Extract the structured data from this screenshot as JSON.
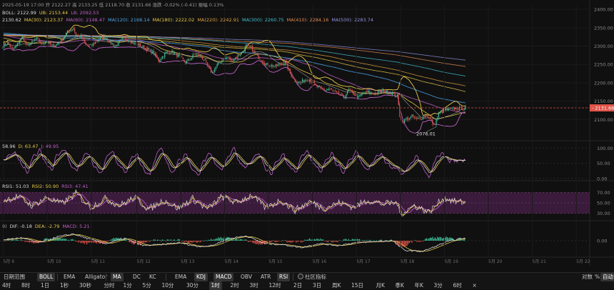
{
  "header": {
    "line1": "2025-05-19 17:00  开 2122.27  高 2133.25  低 2118.70  收 2131.66  涨跌 -0.02% (-0.41)  振幅 0.13%",
    "line2": [
      {
        "text": "BOLL: 2122.99",
        "color": "#d8d8d8"
      },
      {
        "text": "UB: 2153.44",
        "color": "#e6c84a"
      },
      {
        "text": "LB: 2092.53",
        "color": "#c060c8"
      }
    ],
    "line3": [
      {
        "text": "2130.62",
        "color": "#d8d8d8"
      },
      {
        "text": "MA(30): 2123.37",
        "color": "#e6c84a"
      },
      {
        "text": "MA(60): 2148.47",
        "color": "#c060c8"
      },
      {
        "text": "MA(120): 2168.14",
        "color": "#4aa3e6"
      },
      {
        "text": "MA(180): 2222.02",
        "color": "#e6c84a"
      },
      {
        "text": "MA(220): 2242.91",
        "color": "#e0a040"
      },
      {
        "text": "MA(300): 2260.75",
        "color": "#40c0d0"
      },
      {
        "text": "MA(410): 2284.16",
        "color": "#e08a50"
      },
      {
        "text": "MA(500): 2283.74",
        "color": "#9090e0"
      }
    ]
  },
  "kdj_header": [
    {
      "text": "58.96",
      "color": "#d8d8d8"
    },
    {
      "text": "D: 63.47",
      "color": "#e6c84a"
    },
    {
      "text": "J: 49.95",
      "color": "#c060c8"
    }
  ],
  "rsi_header": [
    {
      "text": "RSI1: 51.03",
      "color": "#d8d8d8"
    },
    {
      "text": "RSI2: 50.90",
      "color": "#e6c84a"
    },
    {
      "text": "RSI3: 47.41",
      "color": "#c060c8"
    }
  ],
  "macd_header": [
    {
      "text": "9)",
      "color": "#9a9a9a"
    },
    {
      "text": "DIF: -0.18",
      "color": "#d8d8d8"
    },
    {
      "text": "DEA: -2.79",
      "color": "#e6c84a"
    },
    {
      "text": "MACD: 5.21",
      "color": "#c060c8"
    }
  ],
  "price_axis": [
    "2400.00",
    "2350.00",
    "2300.00",
    "2250.00",
    "2200.00",
    "2150.00",
    "2100.00"
  ],
  "kdj_axis": [
    "100.00",
    "50.00",
    "0.00"
  ],
  "rsi_axis": [
    "70.00",
    "50.00",
    "30.00"
  ],
  "macd_axis": [
    "0.00"
  ],
  "x_labels": [
    "5月 9",
    "5月 10",
    "5月 11",
    "5月 12",
    "5月 13",
    "5月 14",
    "5月 15",
    "5月 16",
    "5月 17",
    "5月 18",
    "5月 19",
    "5月 20",
    "5月 21",
    "5月 22"
  ],
  "current_price_label": "2131.66",
  "low_label": "2076.01",
  "indicator_bar": {
    "left_label": "日期范围",
    "items": [
      "BOLL",
      "EMA",
      "Alligator",
      "MA",
      "DC",
      "KC",
      "EMA",
      "KDJ",
      "MACD",
      "OBV",
      "ATR",
      "RSI",
      "社区指标"
    ],
    "active": [
      "BOLL",
      "MA",
      "KDJ",
      "MACD",
      "RSI"
    ],
    "right": [
      "对数",
      "%",
      "自动"
    ]
  },
  "timeframes": [
    "4时",
    "8时",
    "1日",
    "1秒",
    "30秒",
    "分时",
    "1分",
    "5分",
    "10分",
    "30分",
    "1时",
    "2时",
    "3时",
    "12时",
    "2日",
    "3日",
    "周K",
    "15日",
    "月K",
    "季K",
    "年K",
    "3分",
    "6时",
    "×"
  ],
  "active_timeframe": "1时",
  "colors": {
    "up": "#3fc29a",
    "down": "#e0544a",
    "bg": "#101010",
    "rsi_band": "#4a1f4a"
  },
  "chart_data": {
    "type": "candlestick",
    "x_range": [
      "5月 9",
      "5月 22"
    ],
    "ylim": [
      2050,
      2410
    ],
    "anchors": [
      [
        0,
        2300
      ],
      [
        4,
        2310
      ],
      [
        8,
        2290
      ],
      [
        12,
        2305
      ],
      [
        16,
        2325
      ],
      [
        20,
        2300
      ],
      [
        24,
        2310
      ],
      [
        28,
        2320
      ],
      [
        32,
        2305
      ],
      [
        36,
        2315
      ],
      [
        40,
        2300
      ],
      [
        44,
        2305
      ],
      [
        48,
        2315
      ],
      [
        52,
        2335
      ],
      [
        56,
        2345
      ],
      [
        58,
        2350
      ],
      [
        60,
        2330
      ],
      [
        64,
        2325
      ],
      [
        68,
        2305
      ],
      [
        72,
        2300
      ],
      [
        76,
        2310
      ],
      [
        80,
        2320
      ],
      [
        84,
        2325
      ],
      [
        88,
        2310
      ],
      [
        92,
        2300
      ],
      [
        96,
        2312
      ],
      [
        100,
        2322
      ],
      [
        104,
        2316
      ],
      [
        108,
        2306
      ],
      [
        112,
        2303
      ],
      [
        116,
        2296
      ],
      [
        120,
        2290
      ],
      [
        124,
        2280
      ],
      [
        128,
        2260
      ],
      [
        130,
        2268
      ],
      [
        134,
        2282
      ],
      [
        138,
        2286
      ],
      [
        142,
        2278
      ],
      [
        146,
        2268
      ],
      [
        150,
        2255
      ],
      [
        154,
        2265
      ],
      [
        158,
        2280
      ],
      [
        162,
        2275
      ],
      [
        166,
        2258
      ],
      [
        170,
        2235
      ],
      [
        172,
        2228
      ],
      [
        176,
        2248
      ],
      [
        180,
        2262
      ],
      [
        184,
        2270
      ],
      [
        188,
        2262
      ],
      [
        192,
        2270
      ],
      [
        196,
        2282
      ],
      [
        200,
        2300
      ],
      [
        204,
        2295
      ],
      [
        208,
        2275
      ],
      [
        212,
        2265
      ],
      [
        216,
        2250
      ],
      [
        220,
        2248
      ],
      [
        224,
        2245
      ],
      [
        228,
        2250
      ],
      [
        232,
        2256
      ],
      [
        236,
        2225
      ],
      [
        240,
        2206
      ],
      [
        244,
        2200
      ],
      [
        248,
        2208
      ],
      [
        252,
        2210
      ],
      [
        256,
        2195
      ],
      [
        260,
        2185
      ],
      [
        264,
        2180
      ],
      [
        268,
        2184
      ],
      [
        272,
        2175
      ],
      [
        276,
        2168
      ],
      [
        280,
        2160
      ],
      [
        284,
        2180
      ],
      [
        288,
        2170
      ],
      [
        292,
        2160
      ],
      [
        296,
        2172
      ],
      [
        300,
        2175
      ],
      [
        304,
        2170
      ],
      [
        308,
        2172
      ],
      [
        312,
        2178
      ],
      [
        316,
        2174
      ],
      [
        320,
        2172
      ],
      [
        324,
        2165
      ],
      [
        326,
        2110
      ],
      [
        328,
        2095
      ],
      [
        332,
        2102
      ],
      [
        336,
        2108
      ],
      [
        340,
        2100
      ],
      [
        344,
        2105
      ],
      [
        348,
        2112
      ],
      [
        352,
        2095
      ],
      [
        354,
        2082
      ],
      [
        356,
        2098
      ],
      [
        358,
        2114
      ],
      [
        360,
        2120
      ],
      [
        364,
        2126
      ],
      [
        368,
        2128
      ],
      [
        372,
        2130
      ],
      [
        376,
        2130
      ],
      [
        380,
        2132
      ]
    ],
    "kdj_anchors": [
      [
        0,
        60
      ],
      [
        10,
        80
      ],
      [
        20,
        30
      ],
      [
        30,
        85
      ],
      [
        40,
        40
      ],
      [
        50,
        90
      ],
      [
        60,
        35
      ],
      [
        70,
        75
      ],
      [
        80,
        25
      ],
      [
        90,
        80
      ],
      [
        100,
        30
      ],
      [
        110,
        70
      ],
      [
        120,
        20
      ],
      [
        130,
        85
      ],
      [
        140,
        30
      ],
      [
        150,
        70
      ],
      [
        160,
        20
      ],
      [
        170,
        75
      ],
      [
        180,
        35
      ],
      [
        190,
        85
      ],
      [
        200,
        40
      ],
      [
        210,
        75
      ],
      [
        220,
        25
      ],
      [
        230,
        70
      ],
      [
        240,
        30
      ],
      [
        250,
        80
      ],
      [
        260,
        35
      ],
      [
        270,
        70
      ],
      [
        280,
        30
      ],
      [
        290,
        80
      ],
      [
        300,
        35
      ],
      [
        310,
        75
      ],
      [
        320,
        40
      ],
      [
        330,
        20
      ],
      [
        340,
        65
      ],
      [
        350,
        15
      ],
      [
        360,
        75
      ],
      [
        370,
        60
      ],
      [
        380,
        59
      ]
    ],
    "rsi_anchors": [
      [
        0,
        55
      ],
      [
        12,
        62
      ],
      [
        24,
        45
      ],
      [
        36,
        60
      ],
      [
        48,
        48
      ],
      [
        60,
        68
      ],
      [
        72,
        42
      ],
      [
        84,
        58
      ],
      [
        96,
        45
      ],
      [
        108,
        60
      ],
      [
        120,
        38
      ],
      [
        132,
        55
      ],
      [
        144,
        40
      ],
      [
        156,
        58
      ],
      [
        168,
        38
      ],
      [
        180,
        62
      ],
      [
        192,
        50
      ],
      [
        204,
        65
      ],
      [
        216,
        40
      ],
      [
        228,
        55
      ],
      [
        240,
        36
      ],
      [
        252,
        52
      ],
      [
        264,
        40
      ],
      [
        276,
        50
      ],
      [
        288,
        42
      ],
      [
        300,
        55
      ],
      [
        312,
        48
      ],
      [
        324,
        50
      ],
      [
        326,
        28
      ],
      [
        338,
        45
      ],
      [
        350,
        32
      ],
      [
        362,
        60
      ],
      [
        372,
        52
      ],
      [
        380,
        51
      ]
    ],
    "macd_anchors": [
      [
        0,
        2
      ],
      [
        15,
        6
      ],
      [
        30,
        -4
      ],
      [
        45,
        8
      ],
      [
        58,
        14
      ],
      [
        70,
        4
      ],
      [
        85,
        -6
      ],
      [
        100,
        5
      ],
      [
        115,
        -10
      ],
      [
        130,
        -8
      ],
      [
        145,
        -4
      ],
      [
        160,
        -12
      ],
      [
        172,
        -10
      ],
      [
        185,
        4
      ],
      [
        200,
        10
      ],
      [
        215,
        -6
      ],
      [
        230,
        -8
      ],
      [
        245,
        -14
      ],
      [
        260,
        -6
      ],
      [
        275,
        -10
      ],
      [
        290,
        -4
      ],
      [
        305,
        -2
      ],
      [
        320,
        0
      ],
      [
        330,
        -20
      ],
      [
        345,
        -22
      ],
      [
        355,
        -12
      ],
      [
        365,
        -2
      ],
      [
        375,
        4
      ],
      [
        380,
        5
      ]
    ]
  }
}
